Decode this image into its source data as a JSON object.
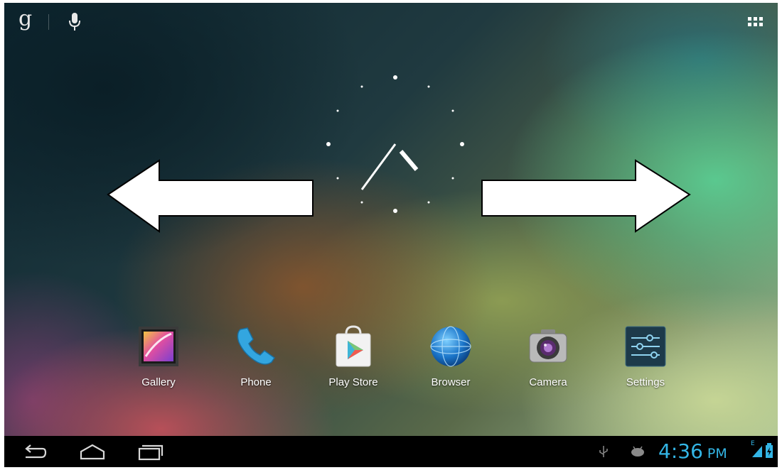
{
  "search_bar": {
    "logo_text": "g",
    "icons": [
      "google-search-icon",
      "microphone-icon"
    ]
  },
  "header": {
    "apps_icon": "all-apps-grid-icon"
  },
  "clock_widget": {
    "type": "analog-clock",
    "hour": 4,
    "minute": 36
  },
  "overlay": {
    "arrows": [
      "swipe-left-arrow",
      "swipe-right-arrow"
    ]
  },
  "dock": {
    "apps": [
      {
        "label": "Gallery",
        "icon": "gallery-icon"
      },
      {
        "label": "Phone",
        "icon": "phone-icon"
      },
      {
        "label": "Play Store",
        "icon": "play-store-icon"
      },
      {
        "label": "Browser",
        "icon": "browser-icon"
      },
      {
        "label": "Camera",
        "icon": "camera-icon"
      },
      {
        "label": "Settings",
        "icon": "settings-icon"
      }
    ]
  },
  "navbar": {
    "buttons": [
      "back-icon",
      "home-icon",
      "recent-apps-icon"
    ],
    "status_icons": [
      "usb-icon",
      "android-debug-icon",
      "signal-icon",
      "battery-icon"
    ],
    "time": "4:36",
    "ampm": "PM",
    "network": "E",
    "accent_color": "#33b5e5"
  }
}
